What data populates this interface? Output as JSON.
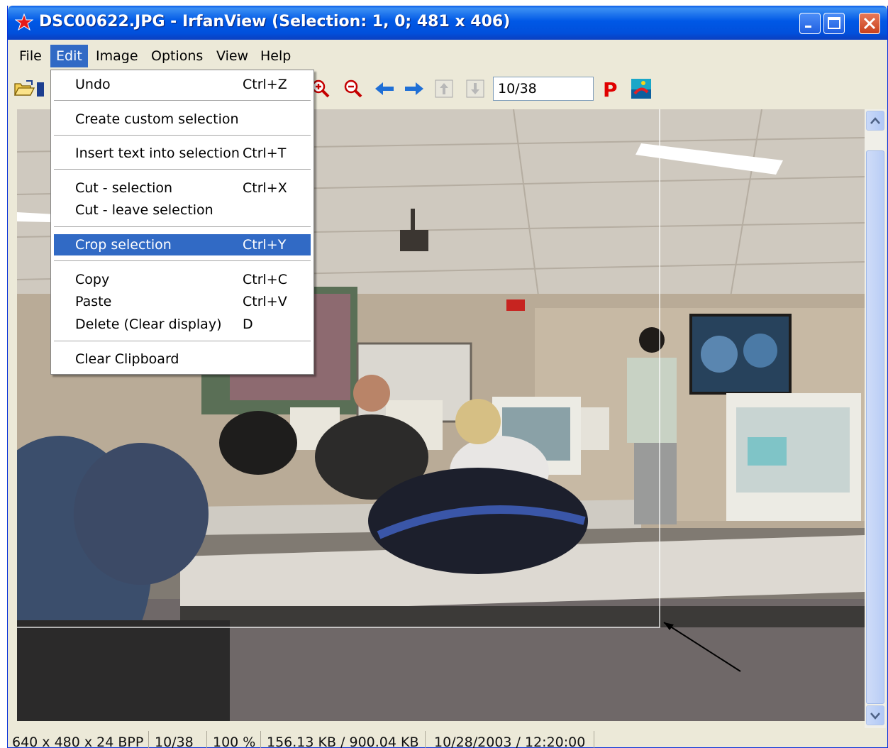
{
  "window": {
    "title": "DSC00622.JPG - IrfanView (Selection: 1, 0; 481 x 406)"
  },
  "menubar": {
    "items": [
      "File",
      "Edit",
      "Image",
      "Options",
      "View",
      "Help"
    ],
    "active": "Edit"
  },
  "toolbar": {
    "icons": [
      "open-folder-icon",
      "zoom-in-icon",
      "zoom-out-icon",
      "previous-arrow-icon",
      "next-arrow-icon",
      "first-page-icon",
      "last-page-icon",
      "print-icon",
      "irfanview-logo-icon"
    ],
    "page_counter": "10/38"
  },
  "edit_menu": {
    "items": [
      {
        "label": "Undo",
        "shortcut": "Ctrl+Z"
      },
      {
        "label": "Create custom selection",
        "shortcut": ""
      },
      {
        "label": "Insert text into selection",
        "shortcut": "Ctrl+T"
      },
      {
        "label": "Cut - selection",
        "shortcut": "Ctrl+X"
      },
      {
        "label": "Cut - leave selection",
        "shortcut": ""
      },
      {
        "label": "Crop selection",
        "shortcut": "Ctrl+Y"
      },
      {
        "label": "Copy",
        "shortcut": "Ctrl+C"
      },
      {
        "label": "Paste",
        "shortcut": "Ctrl+V"
      },
      {
        "label": "Delete (Clear display)",
        "shortcut": "D"
      },
      {
        "label": "Clear Clipboard",
        "shortcut": ""
      }
    ],
    "highlighted": "Crop selection"
  },
  "statusbar": {
    "dimensions": "640 x 480 x 24 BPP",
    "position": "10/38",
    "zoom": "100 %",
    "size": "156.13 KB / 900.04 KB",
    "date": "10/28/2003 / 12:20:00"
  },
  "colors": {
    "titlebar": "#0058e6",
    "menu_highlight": "#316ac5",
    "window_bg": "#ece9d8"
  }
}
